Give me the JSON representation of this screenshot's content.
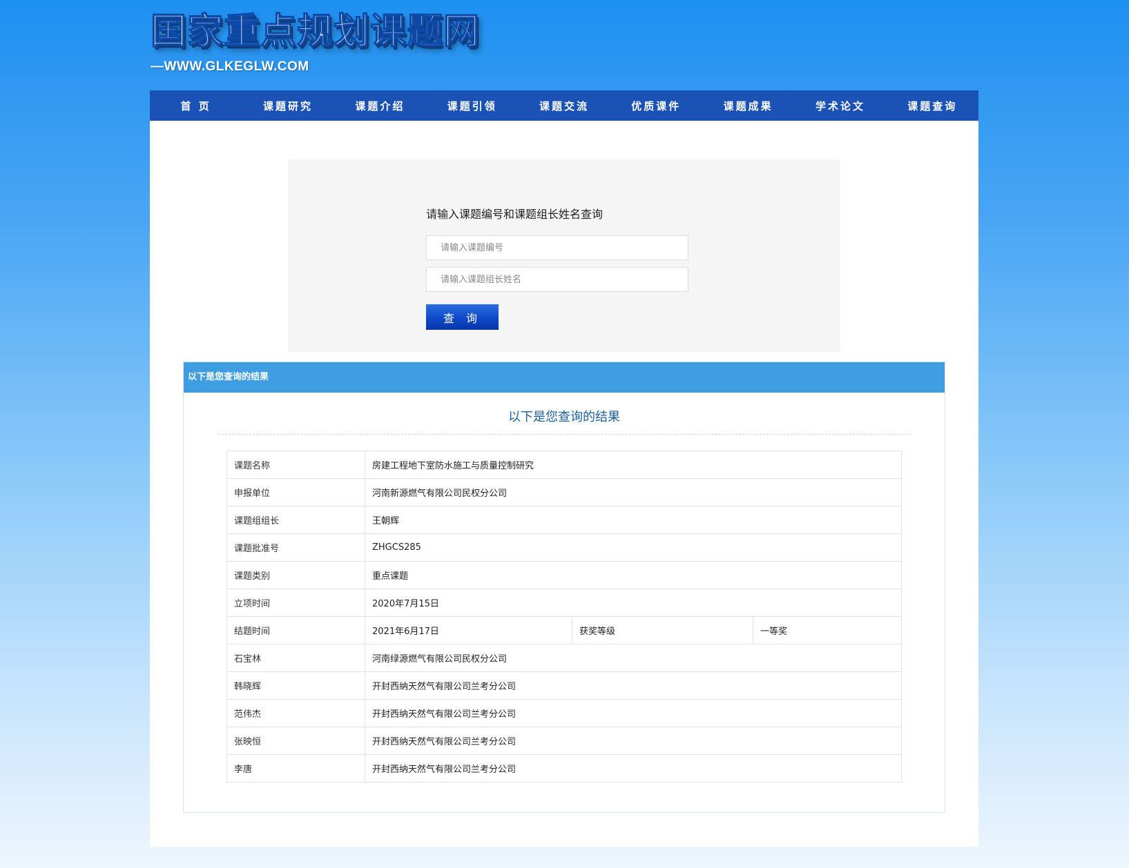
{
  "site": {
    "title": "国家重点规划课题网",
    "subtitle": "—WWW.GLKEGLW.COM"
  },
  "nav": {
    "items": [
      {
        "label": "首 页"
      },
      {
        "label": "课题研究"
      },
      {
        "label": "课题介绍"
      },
      {
        "label": "课题引领"
      },
      {
        "label": "课题交流"
      },
      {
        "label": "优质课件"
      },
      {
        "label": "课题成果"
      },
      {
        "label": "学术论文"
      },
      {
        "label": "课题查询"
      }
    ]
  },
  "query": {
    "title": "请输入课题编号和课题组长姓名查询",
    "code_placeholder": "请输入课题编号",
    "name_placeholder": "请输入课题组长姓名",
    "button_label": "查 询"
  },
  "result": {
    "header": "以下是您查询的结果",
    "title": "以下是您查询的结果",
    "rows": [
      {
        "label": "课题名称",
        "value": "房建工程地下室防水施工与质量控制研究"
      },
      {
        "label": "申报单位",
        "value": "河南新源燃气有限公司民权分公司"
      },
      {
        "label": "课题组组长",
        "value": "王朝辉"
      },
      {
        "label": "课题批准号",
        "value": "ZHGCS285"
      },
      {
        "label": "课题类别",
        "value": "重点课题"
      },
      {
        "label": "立项时间",
        "value": "2020年7月15日"
      }
    ],
    "end_row": {
      "label": "结题时间",
      "value": "2021年6月17日",
      "award_label": "获奖等级",
      "award_value": "一等奖"
    },
    "members": [
      {
        "name": "石宝林",
        "unit": "河南绿源燃气有限公司民权分公司"
      },
      {
        "name": "韩晓辉",
        "unit": "开封西纳天然气有限公司兰考分公司"
      },
      {
        "name": "范伟杰",
        "unit": "开封西纳天然气有限公司兰考分公司"
      },
      {
        "name": "张映恒",
        "unit": "开封西纳天然气有限公司兰考分公司"
      },
      {
        "name": "李唐",
        "unit": "开封西纳天然气有限公司兰考分公司"
      }
    ]
  }
}
